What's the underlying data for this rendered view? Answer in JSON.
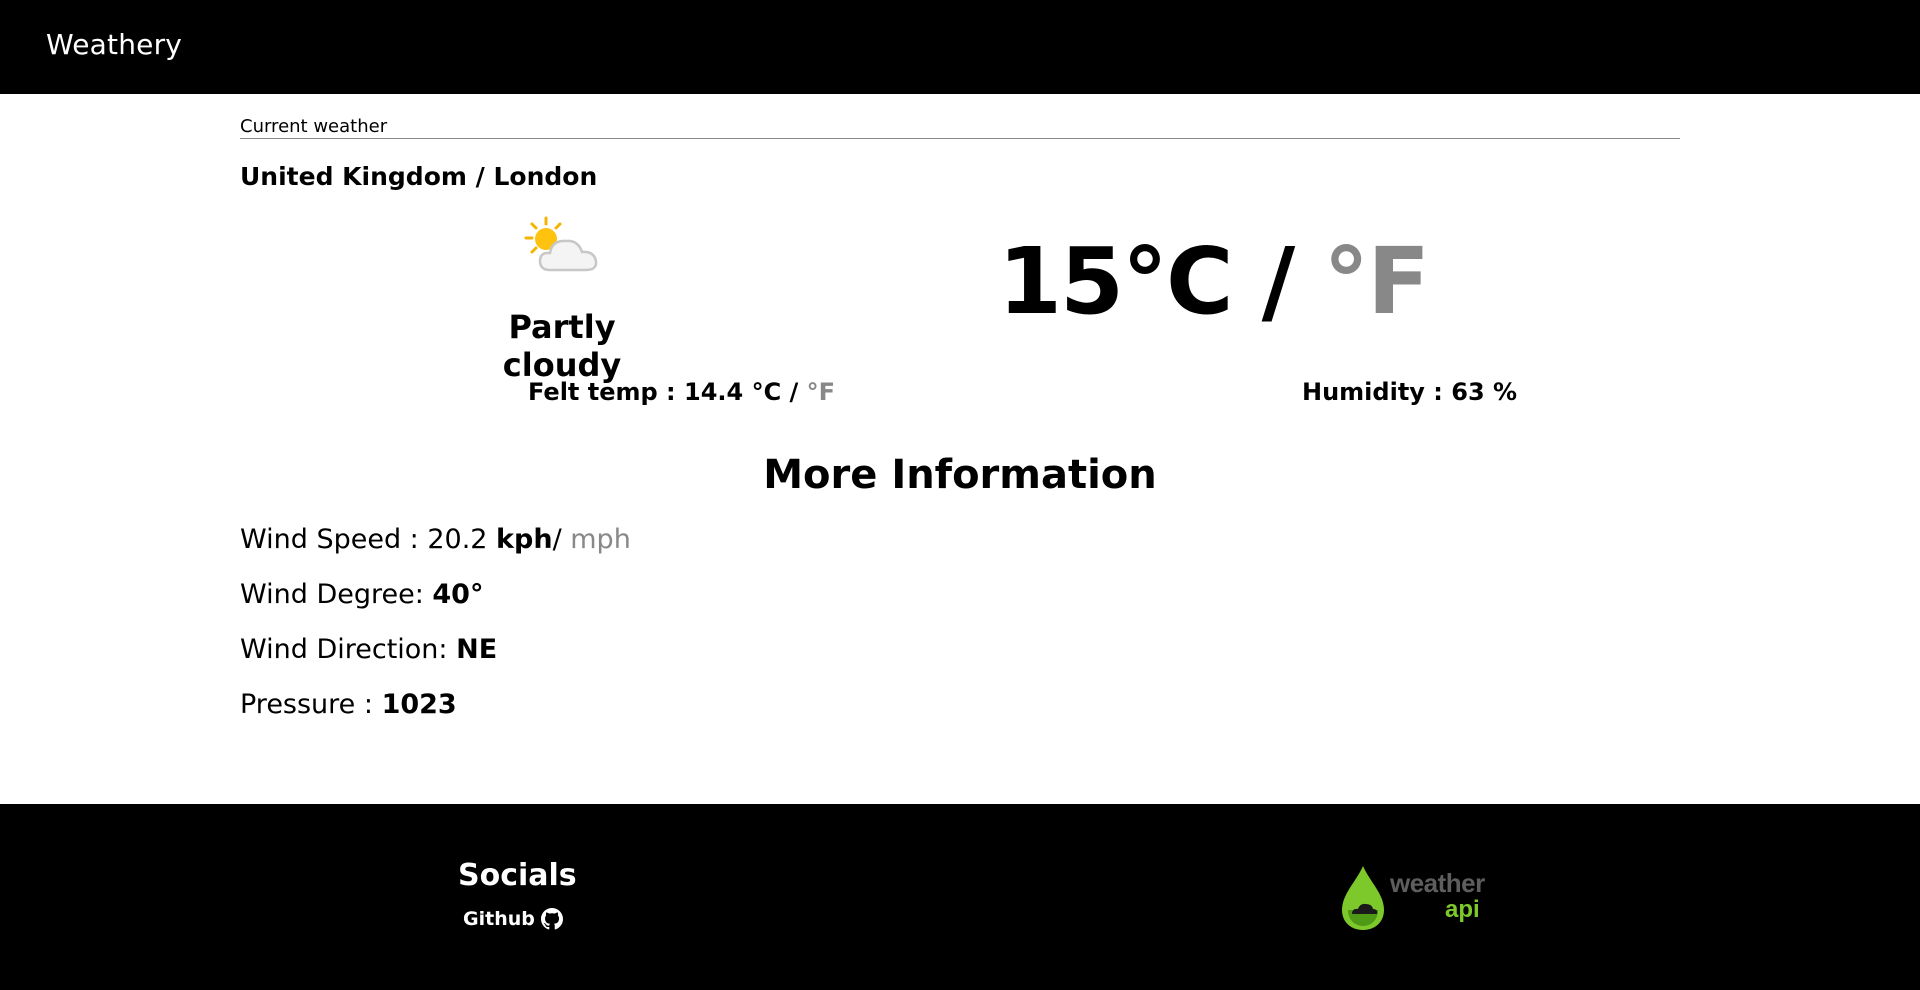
{
  "header": {
    "brand": "Weathery"
  },
  "current": {
    "section_label": "Current weather",
    "location": "United Kingdom / London",
    "icon": "partly-cloudy-icon",
    "condition": "Partly cloudy",
    "temp_c": "15°C / ",
    "temp_f_unit": "°F",
    "felt_label": "Felt temp : 14.4 °C / ",
    "felt_f_unit": "°F",
    "humidity": "Humidity : 63 %"
  },
  "more_info": {
    "title": "More Information",
    "wind_speed_label": "Wind Speed : 20.2 ",
    "wind_speed_unit": "kph",
    "wind_speed_sep": "/ ",
    "wind_speed_alt_unit": "mph",
    "wind_degree_label": "Wind Degree: ",
    "wind_degree_value": "40°",
    "wind_direction_label": "Wind Direction: ",
    "wind_direction_value": "NE",
    "pressure_label": "Pressure : ",
    "pressure_value": "1023"
  },
  "footer": {
    "socials_title": "Socials",
    "github_label": "Github",
    "logo_line1": "weather",
    "logo_line2": "api"
  },
  "colors": {
    "header_bg": "#000000",
    "muted_unit": "#888888",
    "logo_green": "#7dc92c",
    "logo_gray": "#5e5e5e"
  }
}
